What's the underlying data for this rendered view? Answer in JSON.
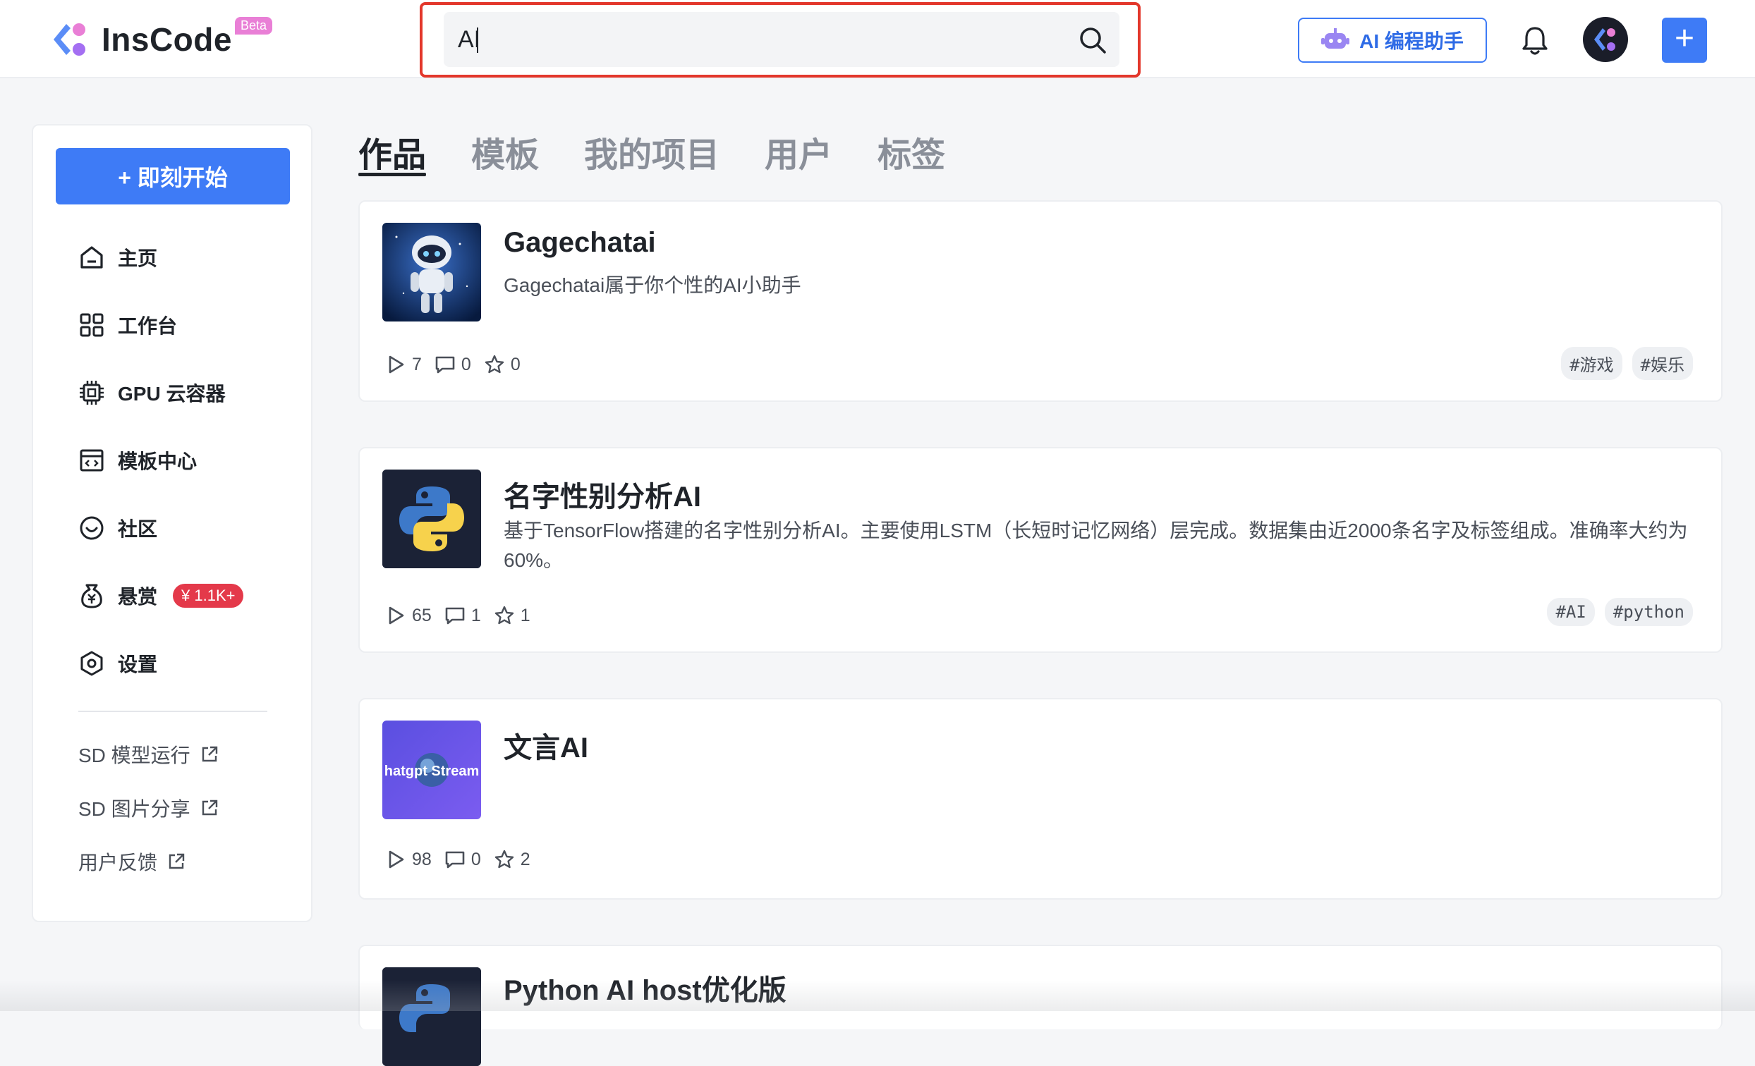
{
  "header": {
    "logo_text": "InsCode",
    "beta_label": "Beta",
    "search_value": "AI",
    "ai_button_label": "AI 编程助手",
    "plus_label": "+"
  },
  "sidebar": {
    "start_label": "+ 即刻开始",
    "items": [
      {
        "label": "主页",
        "icon": "home-icon"
      },
      {
        "label": "工作台",
        "icon": "grid-icon"
      },
      {
        "label": "GPU 云容器",
        "icon": "chip-icon"
      },
      {
        "label": "模板中心",
        "icon": "template-icon"
      },
      {
        "label": "社区",
        "icon": "community-icon"
      },
      {
        "label": "悬赏",
        "icon": "bounty-icon",
        "badge": "¥ 1.1K+"
      },
      {
        "label": "设置",
        "icon": "settings-icon"
      }
    ],
    "links": [
      {
        "label": "SD 模型运行"
      },
      {
        "label": "SD 图片分享"
      },
      {
        "label": "用户反馈"
      }
    ]
  },
  "tabs": [
    "作品",
    "模板",
    "我的项目",
    "用户",
    "标签"
  ],
  "active_tab": "作品",
  "cards": [
    {
      "title": "Gagechatai",
      "desc": "Gagechatai属于你个性的AI小助手",
      "runs": "7",
      "comments": "0",
      "stars": "0",
      "tags": [
        "#游戏",
        "#娱乐"
      ]
    },
    {
      "title": "名字性别分析AI",
      "desc": "基于TensorFlow搭建的名字性别分析AI。主要使用LSTM（长短时记忆网络）层完成。数据集由近2000条名字及标签组成。准确率大约为60%。",
      "runs": "65",
      "comments": "1",
      "stars": "1",
      "tags": [
        "#AI",
        "#python"
      ]
    },
    {
      "title": "文言AI",
      "thumb_text": "hatgpt Stream",
      "desc": "",
      "runs": "98",
      "comments": "0",
      "stars": "2",
      "tags": []
    },
    {
      "title": "Python AI host优化版"
    }
  ],
  "colors": {
    "accent": "#3e7bf6",
    "highlight_border": "#e3372b",
    "badge": "#e4394a"
  }
}
